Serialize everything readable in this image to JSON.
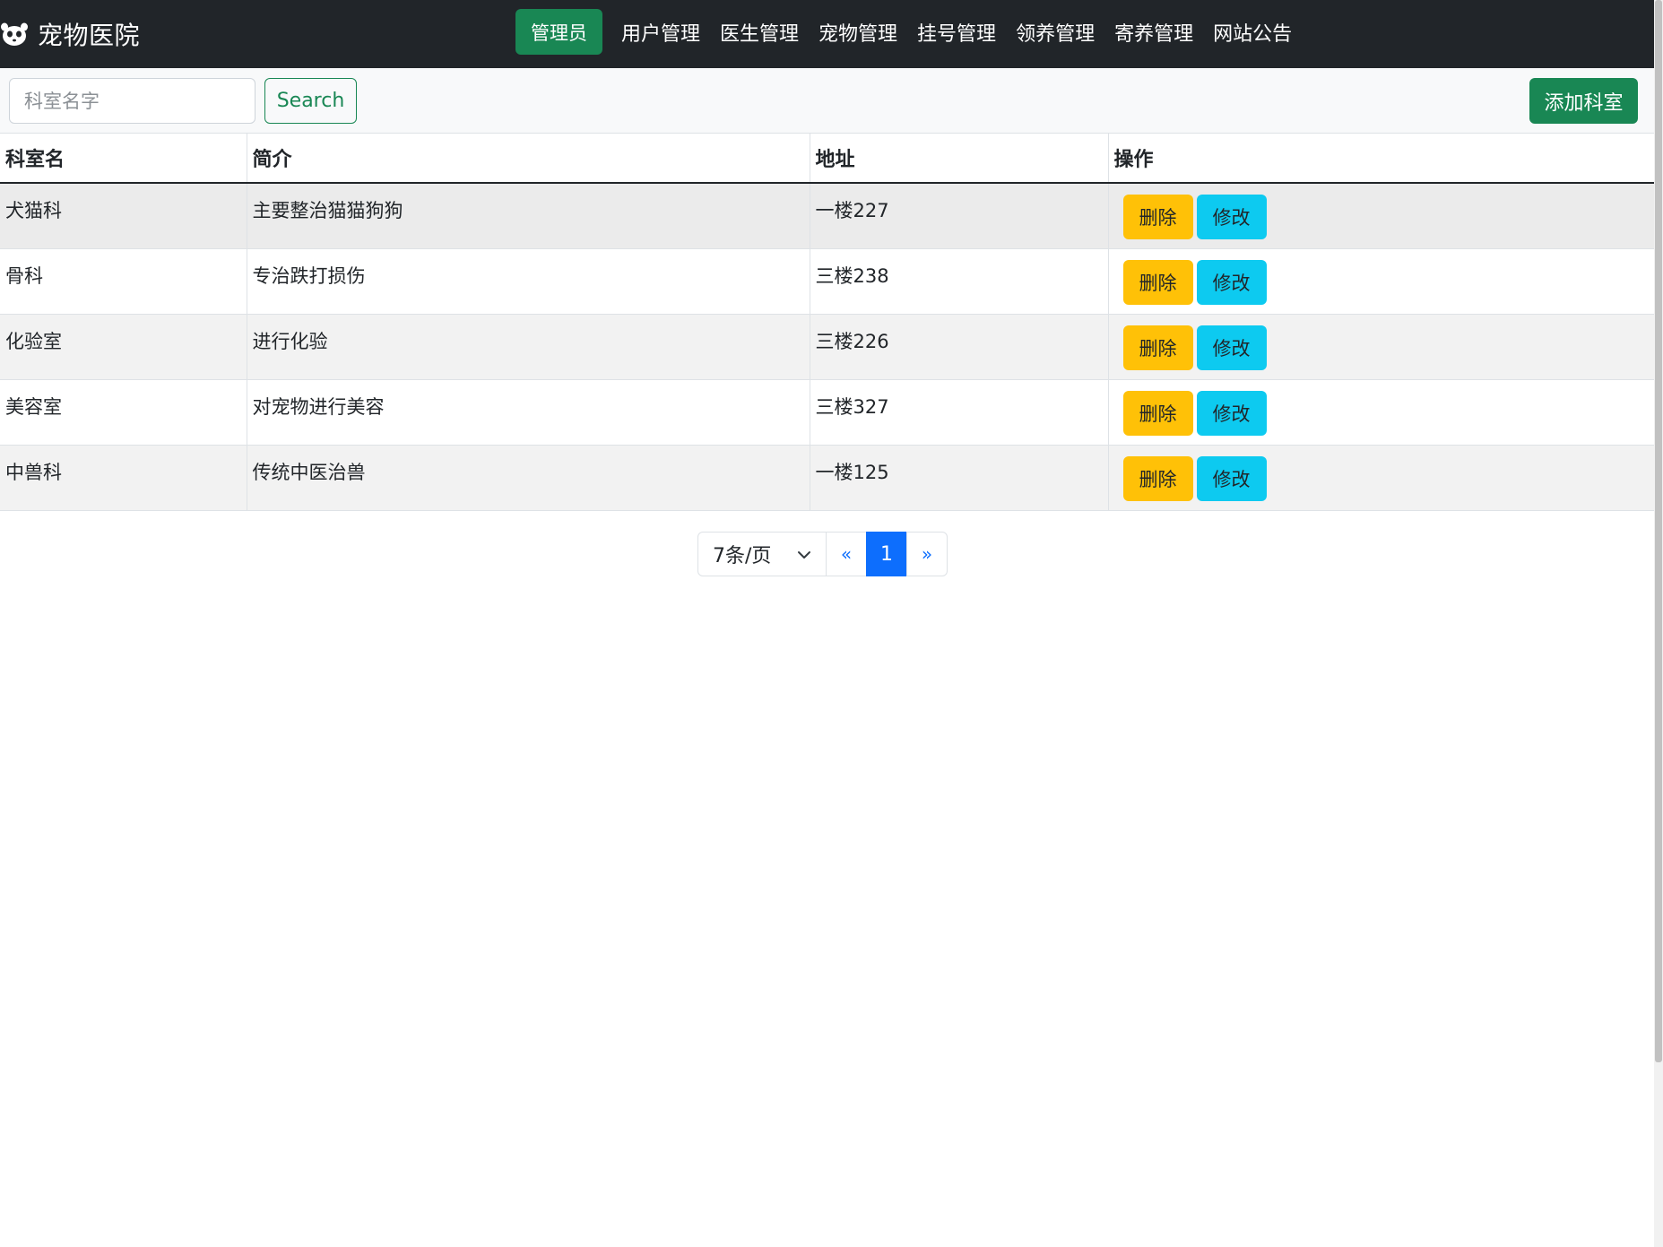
{
  "brand": {
    "title": "宠物医院",
    "icon": "pet-paw-icon"
  },
  "nav": {
    "active": "管理员",
    "items": [
      "用户管理",
      "医生管理",
      "宠物管理",
      "挂号管理",
      "领养管理",
      "寄养管理",
      "网站公告"
    ]
  },
  "toolbar": {
    "search_placeholder": "科室名字",
    "search_value": "",
    "search_label": "Search",
    "add_label": "添加科室"
  },
  "table": {
    "headers": [
      "科室名",
      "简介",
      "地址",
      "操作"
    ],
    "rows": [
      {
        "name": "犬猫科",
        "intro": "主要整治猫猫狗狗",
        "address": "一楼227"
      },
      {
        "name": "骨科",
        "intro": "专治跌打损伤",
        "address": "三楼238"
      },
      {
        "name": "化验室",
        "intro": "进行化验",
        "address": "三楼226"
      },
      {
        "name": "美容室",
        "intro": "对宠物进行美容",
        "address": "三楼327"
      },
      {
        "name": "中兽科",
        "intro": "传统中医治兽",
        "address": "一楼125"
      }
    ],
    "delete_label": "删除",
    "edit_label": "修改"
  },
  "pagination": {
    "page_size": "7条/页",
    "prev": "«",
    "current": "1",
    "next": "»"
  },
  "colors": {
    "navbar": "#212529",
    "success": "#198754",
    "warning": "#ffc107",
    "info": "#0dcaf0",
    "primary": "#0d6efd"
  }
}
